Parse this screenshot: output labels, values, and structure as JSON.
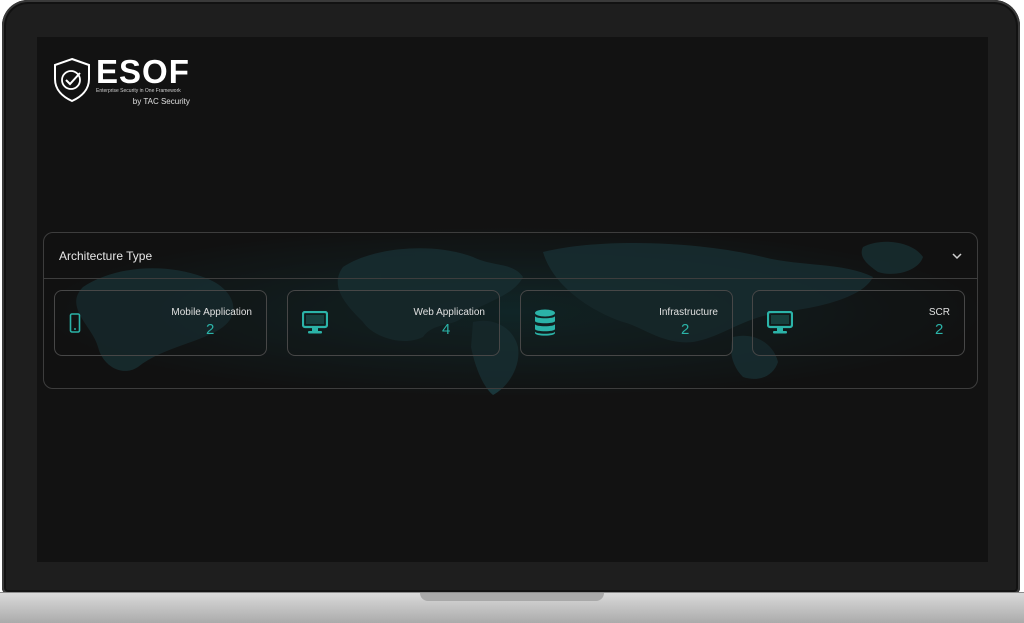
{
  "brand": {
    "name": "ESOF",
    "tagline": "Enterprise Security in One Framework",
    "byline": "by TAC Security"
  },
  "panel": {
    "title": "Architecture Type",
    "cards": [
      {
        "label": "Mobile Application",
        "count": "2",
        "icon": "mobile-phone-icon"
      },
      {
        "label": "Web Application",
        "count": "4",
        "icon": "monitor-icon"
      },
      {
        "label": "Infrastructure",
        "count": "2",
        "icon": "database-icon"
      },
      {
        "label": "SCR",
        "count": "2",
        "icon": "monitor-icon"
      }
    ]
  },
  "colors": {
    "accent": "#2bb3a8",
    "background": "#121212",
    "border": "#3d3d3d"
  }
}
